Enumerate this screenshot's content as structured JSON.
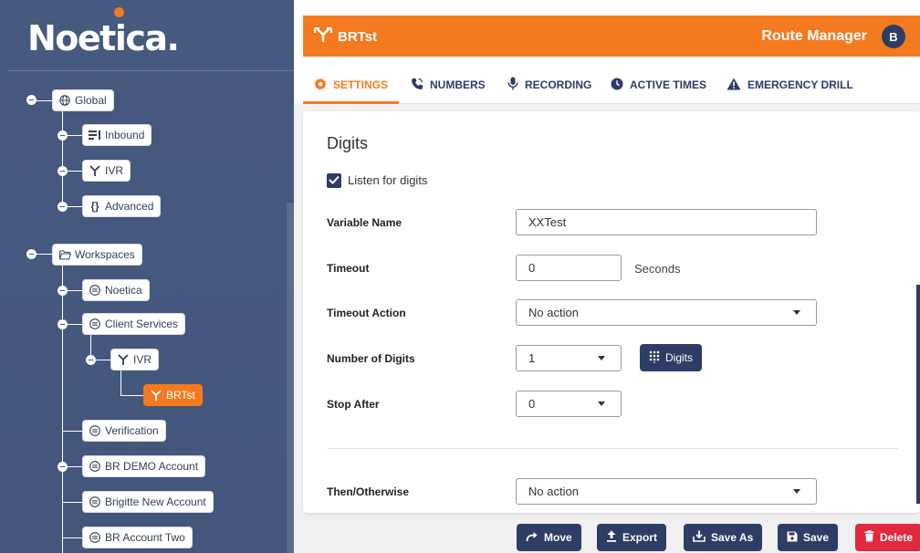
{
  "brand": {
    "logo_text": "Noetica",
    "logo_suffix": "."
  },
  "tree": {
    "global": "Global",
    "inbound": "Inbound",
    "ivr": "IVR",
    "advanced": "Advanced",
    "workspaces": "Workspaces",
    "noetica": "Noetica",
    "client_services": "Client Services",
    "cs_ivr": "IVR",
    "brtst": "BRTst",
    "verification": "Verification",
    "br_demo_account": "BR DEMO Account",
    "brigitte_new_account": "Brigitte New Account",
    "br_account_two": "BR Account Two"
  },
  "header": {
    "title": "BRTst",
    "app_name": "Route Manager",
    "avatar_initial": "B"
  },
  "tabs": [
    {
      "label": "SETTINGS"
    },
    {
      "label": "NUMBERS"
    },
    {
      "label": "RECORDING"
    },
    {
      "label": "ACTIVE TIMES"
    },
    {
      "label": "EMERGENCY DRILL"
    }
  ],
  "digits": {
    "section_title": "Digits",
    "listen_label": "Listen for digits",
    "listen_checked": true,
    "variable_name_label": "Variable Name",
    "variable_name_value": "XXTest",
    "timeout_label": "Timeout",
    "timeout_value": "0",
    "timeout_unit": "Seconds",
    "timeout_action_label": "Timeout Action",
    "timeout_action_value": "No action",
    "number_of_digits_label": "Number of Digits",
    "number_of_digits_value": "1",
    "digits_button": "Digits",
    "stop_after_label": "Stop After",
    "stop_after_value": "0",
    "then_otherwise_label": "Then/Otherwise",
    "then_otherwise_value": "No action"
  },
  "actions": {
    "move": "Move",
    "export": "Export",
    "save_as": "Save As",
    "save": "Save",
    "delete": "Delete"
  },
  "colors": {
    "accent": "#f47a20",
    "navy": "#2d3d65",
    "sidebar": "#46597f",
    "danger": "#e2293f"
  }
}
